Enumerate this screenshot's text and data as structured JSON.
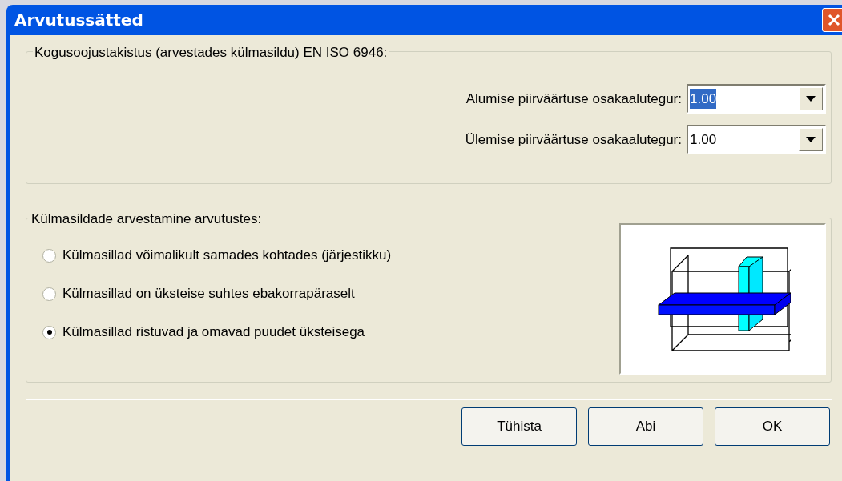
{
  "window": {
    "title": "Arvutussätted"
  },
  "group_total": {
    "title": "Kogusoojustakistus (arvestades külmasildu) EN ISO 6946:",
    "fields": [
      {
        "label": "Alumise piirväärtuse osakaalutegur:",
        "value": "1.00",
        "focused": true
      },
      {
        "label": "Ülemise piirväärtuse osakaalutegur:",
        "value": "1.00",
        "focused": false
      }
    ]
  },
  "group_bridges": {
    "title": "Külmasildade arvestamine arvutustes:",
    "options": [
      {
        "label": "Külmasillad võimalikult samades kohtades (järjestikku)",
        "selected": false
      },
      {
        "label": "Külmasillad on üksteise suhtes ebakorrapäraselt",
        "selected": false
      },
      {
        "label": "Külmasillad ristuvad ja omavad puudet üksteisega",
        "selected": true
      }
    ]
  },
  "buttons": [
    "Tühista",
    "Abi",
    "OK"
  ]
}
